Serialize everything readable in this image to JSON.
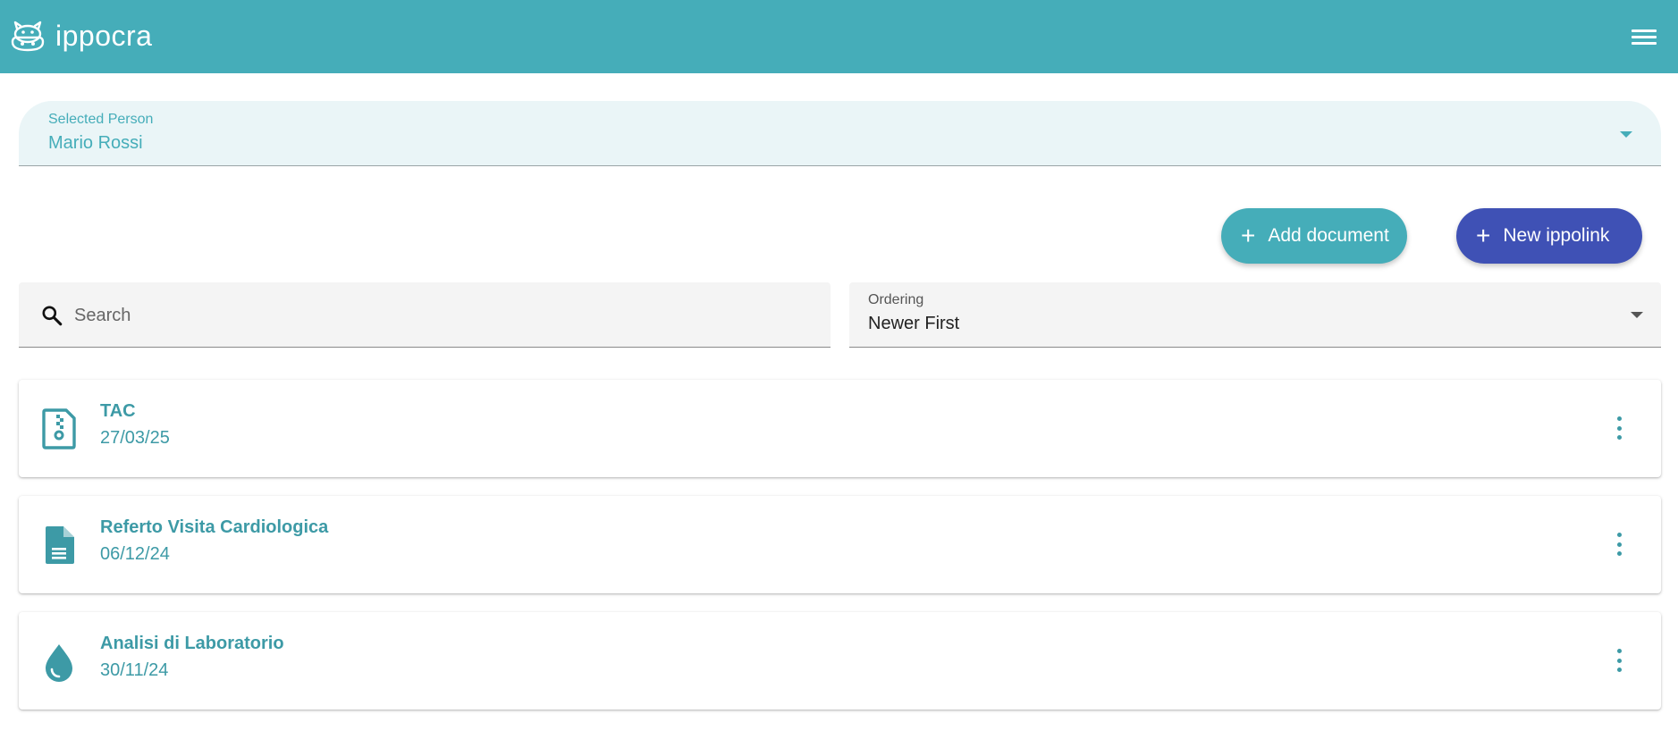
{
  "header": {
    "brand": "ippocra",
    "logo_icon": "hippo-logo-icon",
    "menu_icon": "hamburger-menu-icon",
    "color": "#45adb9"
  },
  "person_select": {
    "label": "Selected Person",
    "value": "Mario Rossi"
  },
  "actions": {
    "add_document": "Add document",
    "new_ippolink": "New ippolink",
    "add_color": "#45adb9",
    "new_color": "#3f51b5"
  },
  "search": {
    "placeholder": "Search",
    "icon": "search-icon"
  },
  "ordering": {
    "label": "Ordering",
    "value": "Newer First"
  },
  "documents": [
    {
      "title": "TAC",
      "date": "27/03/25",
      "icon": "zip-file-icon"
    },
    {
      "title": "Referto Visita Cardiologica",
      "date": "06/12/24",
      "icon": "document-icon"
    },
    {
      "title": "Analisi di Laboratorio",
      "date": "30/11/24",
      "icon": "blood-drop-icon"
    }
  ]
}
